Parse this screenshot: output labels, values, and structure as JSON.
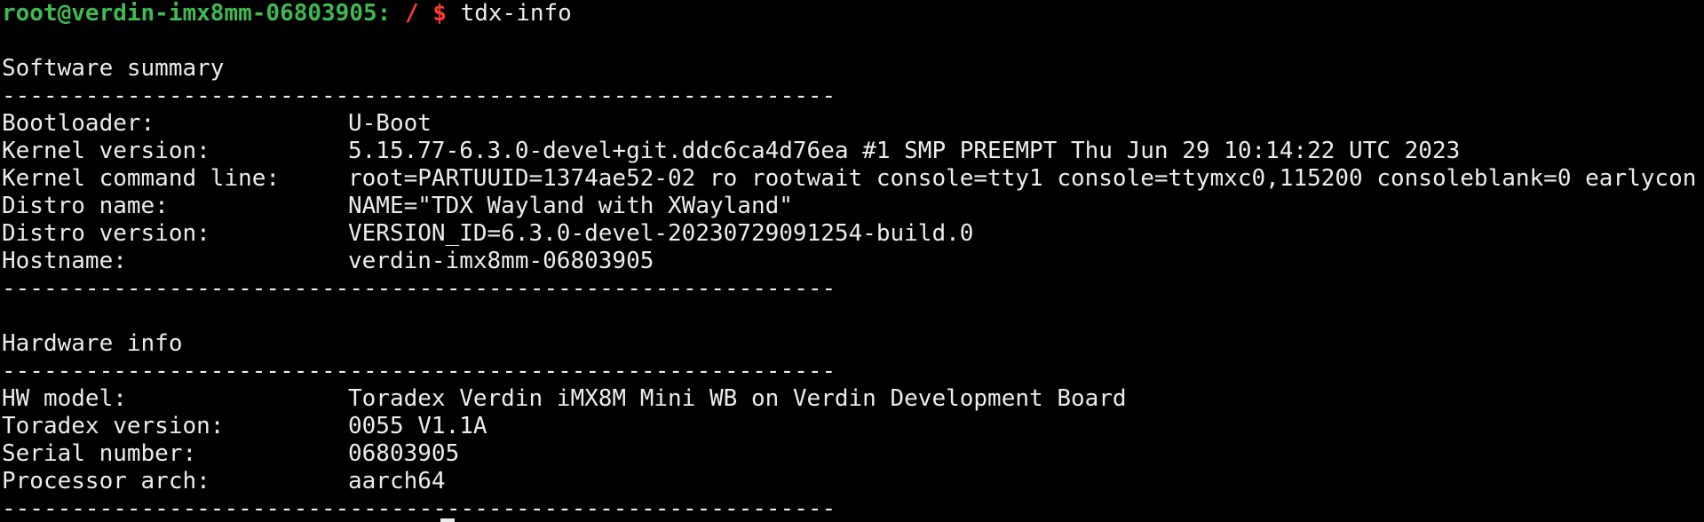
{
  "prompt": {
    "user_host": "root@verdin-imx8mm-06803905:",
    "path": "/",
    "symbol": "$",
    "command": "tdx-info"
  },
  "software": {
    "header": "Software summary",
    "rule": "------------------------------------------------------------",
    "rows": [
      {
        "key": "Bootloader:",
        "value": "U-Boot"
      },
      {
        "key": "Kernel version:",
        "value": "5.15.77-6.3.0-devel+git.ddc6ca4d76ea #1 SMP PREEMPT Thu Jun 29 10:14:22 UTC 2023"
      },
      {
        "key": "Kernel command line:",
        "value": "root=PARTUUID=1374ae52-02 ro rootwait console=tty1 console=ttymxc0,115200 consoleblank=0 earlycon"
      },
      {
        "key": "Distro name:",
        "value": "NAME=\"TDX Wayland with XWayland\""
      },
      {
        "key": "Distro version:",
        "value": "VERSION_ID=6.3.0-devel-20230729091254-build.0"
      },
      {
        "key": "Hostname:",
        "value": "verdin-imx8mm-06803905"
      }
    ]
  },
  "hardware": {
    "header": "Hardware info",
    "rule": "------------------------------------------------------------",
    "rows": [
      {
        "key": "HW model:",
        "value": "Toradex Verdin iMX8M Mini WB on Verdin Development Board"
      },
      {
        "key": "Toradex version:",
        "value": "0055 V1.1A"
      },
      {
        "key": "Serial number:",
        "value": "06803905"
      },
      {
        "key": "Processor arch:",
        "value": "aarch64"
      }
    ]
  },
  "colors": {
    "background": "#000000",
    "text": "#ececec",
    "prompt_user": "#3fb950",
    "prompt_path": "#ff3b30"
  }
}
